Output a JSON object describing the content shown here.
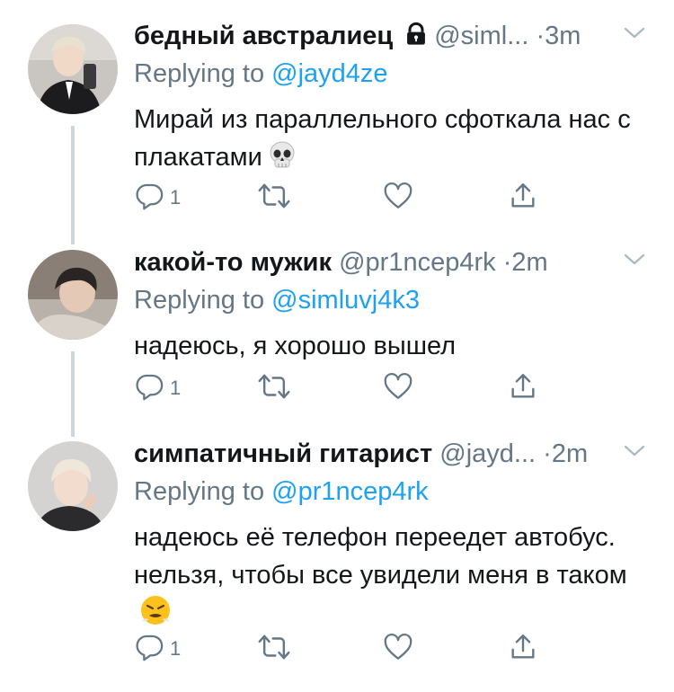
{
  "tweets": [
    {
      "name": "бедный австралиец",
      "handle": "@siml...",
      "dot": "·",
      "time": "3m",
      "replying_label": "Replying to",
      "replying_to": "@jayd4ze",
      "text": "Мирай из параллельного сфоткала нас с плакатами",
      "emoji_icon": "skull-emoji",
      "reply_count": "1",
      "protected": true
    },
    {
      "name": "какой-то мужик",
      "handle": "@pr1ncep4rk",
      "dot": "·",
      "time": "2m",
      "replying_label": "Replying to",
      "replying_to": "@simluvj4k3",
      "text": "надеюсь, я хорошо вышел",
      "reply_count": "1",
      "protected": false
    },
    {
      "name": "симпатичный гитарист",
      "handle": "@jayd...",
      "dot": "·",
      "time": "2m",
      "replying_label": "Replying to",
      "replying_to": "@pr1ncep4rk",
      "text": "надеюсь её телефон переедет автобус. нельзя, чтобы все увидели меня в таком",
      "emoji_icon": "steam-face-emoji",
      "reply_count": "1",
      "protected": false
    }
  ],
  "colors": {
    "name": "#14171a",
    "secondary": "#657786",
    "mention": "#1da1f2",
    "thread_line": "#ccd6dd"
  }
}
